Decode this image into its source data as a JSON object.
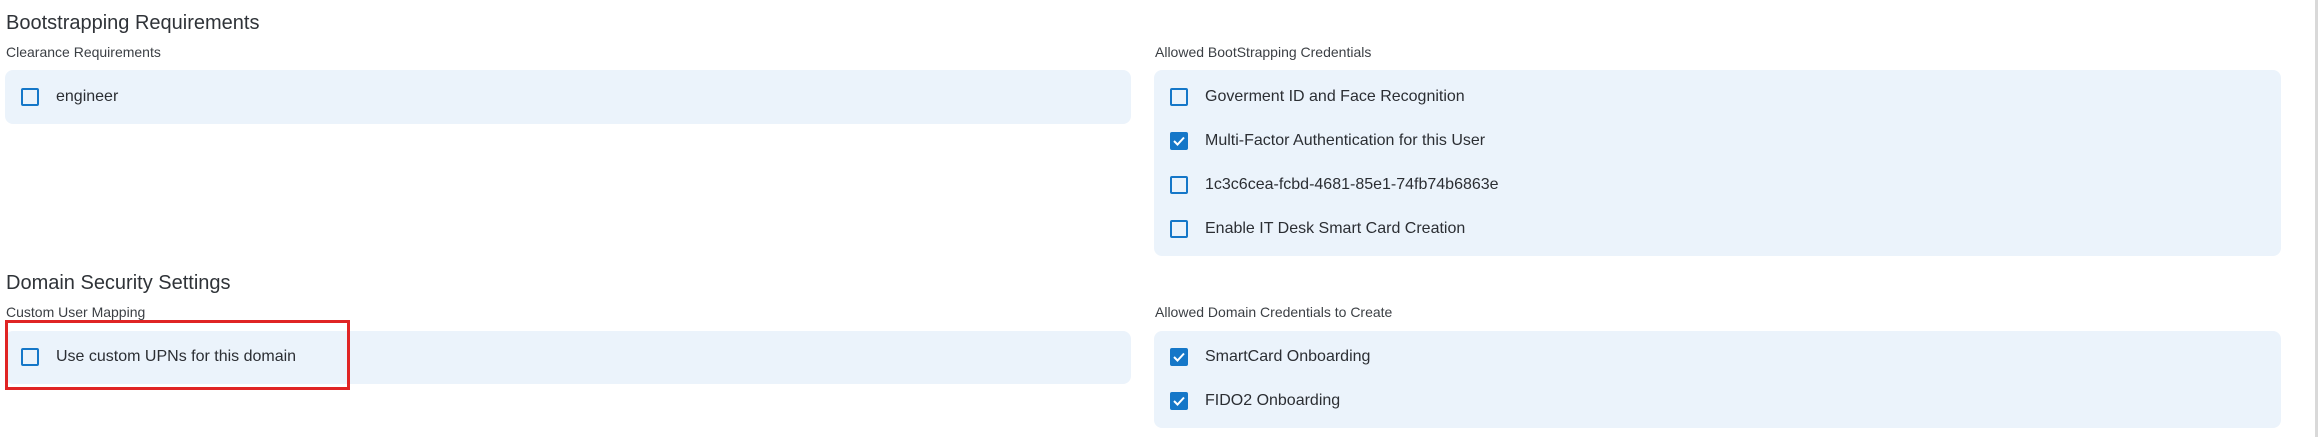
{
  "bootstrapping": {
    "title": "Bootstrapping Requirements",
    "clearance": {
      "label": "Clearance Requirements",
      "options": [
        {
          "label": "engineer",
          "checked": false
        }
      ]
    },
    "credentials": {
      "label": "Allowed BootStrapping Credentials",
      "options": [
        {
          "label": "Goverment ID and Face Recognition",
          "checked": false
        },
        {
          "label": "Multi-Factor Authentication for this User",
          "checked": true
        },
        {
          "label": "1c3c6cea-fcbd-4681-85e1-74fb74b6863e",
          "checked": false
        },
        {
          "label": "Enable IT Desk Smart Card Creation",
          "checked": false
        }
      ]
    }
  },
  "domain_security": {
    "title": "Domain Security Settings",
    "mapping": {
      "label": "Custom User Mapping",
      "options": [
        {
          "label": "Use custom UPNs for this domain",
          "checked": false
        }
      ]
    },
    "domain_credentials": {
      "label": "Allowed Domain Credentials to Create",
      "options": [
        {
          "label": "SmartCard Onboarding",
          "checked": true
        },
        {
          "label": "FIDO2 Onboarding",
          "checked": true
        }
      ]
    }
  },
  "colors": {
    "accent": "#1577c8",
    "panel": "#ebf3fb",
    "highlight": "#e02424"
  }
}
